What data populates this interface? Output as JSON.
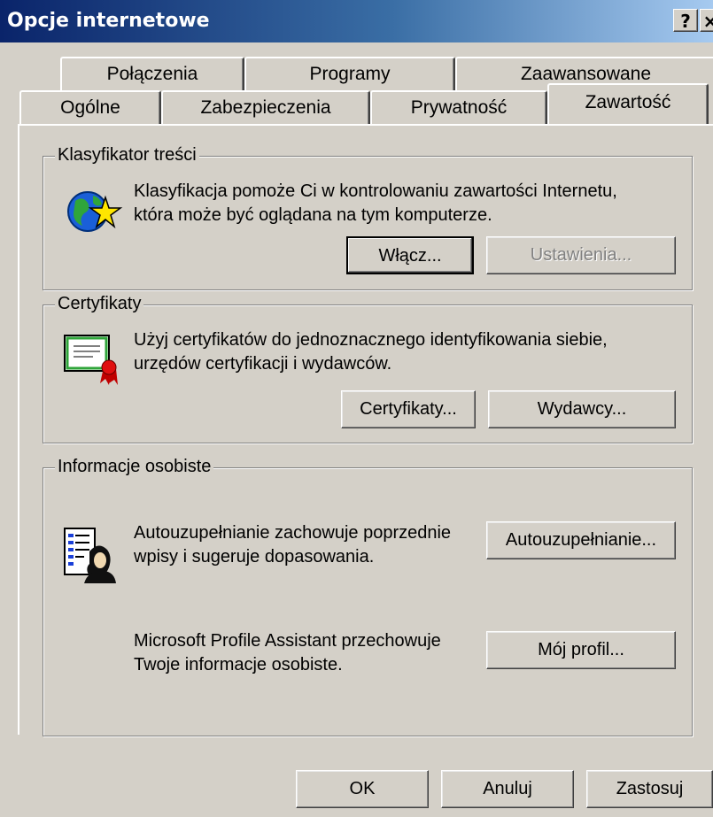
{
  "window": {
    "title": "Opcje internetowe",
    "help_button": "?",
    "close_button": "×"
  },
  "tabs": {
    "back_row": [
      "Połączenia",
      "Programy",
      "Zaawansowane"
    ],
    "front_row": [
      "Ogólne",
      "Zabezpieczenia",
      "Prywatność",
      "Zawartość"
    ],
    "active": "Zawartość"
  },
  "content_advisor": {
    "title": "Klasyfikator treści",
    "description_line1": "Klasyfikacja pomoże Ci w kontrolowaniu zawartości Internetu,",
    "description_line2": "która może być oglądana na tym komputerze.",
    "enable_button": "Włącz...",
    "settings_button": "Ustawienia..."
  },
  "certificates": {
    "title": "Certyfikaty",
    "description_line1": "Użyj certyfikatów do jednoznacznego identyfikowania siebie,",
    "description_line2": "urzędów certyfikacji i wydawców.",
    "certificates_button": "Certyfikaty...",
    "publishers_button": "Wydawcy..."
  },
  "personal_info": {
    "title": "Informacje osobiste",
    "autocomplete_line1": "Autouzupełnianie zachowuje poprzednie",
    "autocomplete_line2": "wpisy i sugeruje dopasowania.",
    "autocomplete_button": "Autouzupełnianie...",
    "profile_line1": "Microsoft Profile Assistant przechowuje",
    "profile_line2": "Twoje informacje osobiste.",
    "profile_button": "Mój profil..."
  },
  "footer": {
    "ok": "OK",
    "cancel": "Anuluj",
    "apply": "Zastosuj"
  },
  "colors": {
    "face": "#d4d0c8",
    "title_start": "#0a246a",
    "title_end": "#a6caf0"
  }
}
